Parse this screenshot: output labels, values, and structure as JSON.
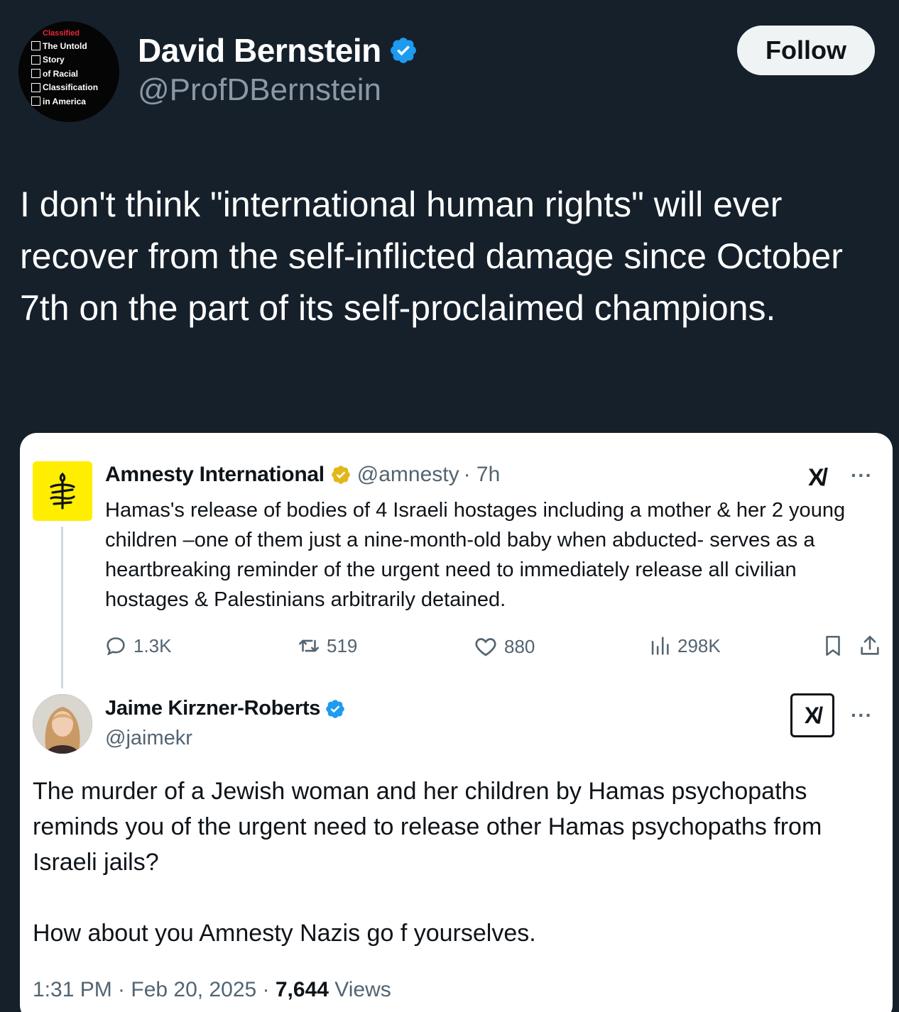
{
  "author": {
    "name": "David Bernstein",
    "handle": "@ProfDBernstein",
    "avatar_book": {
      "red_title": "Classified",
      "lines": [
        "The Untold",
        "Story",
        "of Racial",
        "Classification",
        "in America"
      ]
    },
    "follow_label": "Follow"
  },
  "tweet": {
    "text": "I don't think \"international human rights\" will ever recover from the self-inflicted damage since October 7th on the part of its self-proclaimed champions."
  },
  "quoted": {
    "amnesty": {
      "name": "Amnesty International",
      "handle": "@amnesty",
      "time": "· 7h",
      "x_mark": "X/",
      "more": "···",
      "text": "Hamas's release of bodies of 4 Israeli hostages including a mother & her 2 young children –one of them just a nine-month-old baby when abducted- serves as a heartbreaking reminder of the urgent need to immediately release all civilian hostages & Palestinians arbitrarily detained.",
      "replies": "1.3K",
      "reposts": "519",
      "likes": "880",
      "views": "298K"
    },
    "jaime": {
      "name": "Jaime Kirzner-Roberts",
      "handle": "@jaimekr",
      "x_mark": "X/",
      "more": "···",
      "text_p1": "The murder of a Jewish woman and her children by Hamas psychopaths reminds you of the urgent need to release other Hamas psychopaths from Israeli jails?",
      "text_p2": "How about you Amnesty Nazis go f yourselves.",
      "time": "1:31 PM · Feb 20, 2025 · ",
      "views_count": "7,644",
      "views_label": " Views"
    }
  },
  "colors": {
    "background": "#15202b",
    "verified_blue": "#1d9bf0",
    "gold_badge": "#e2b719",
    "amnesty_yellow": "#ffee00",
    "muted_text": "#536471"
  },
  "icons": [
    "verified-badge-icon",
    "gold-badge-icon",
    "amnesty-candle-icon",
    "reply-icon",
    "repost-icon",
    "like-icon",
    "views-icon",
    "bookmark-icon",
    "share-icon",
    "more-icon"
  ]
}
